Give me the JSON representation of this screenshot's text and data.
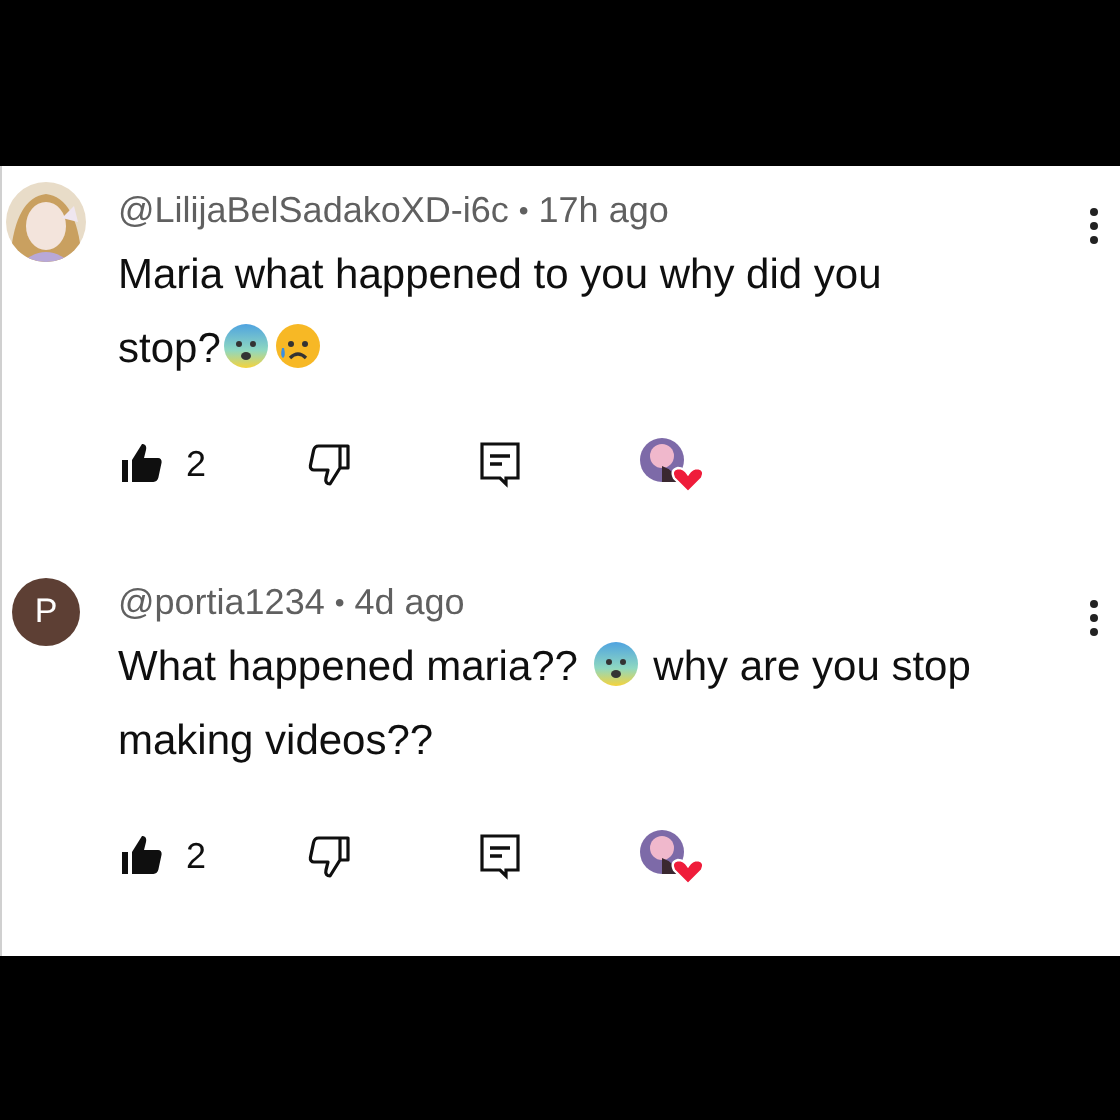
{
  "comments": [
    {
      "author": "@LilijaBelSadakoXD-i6c",
      "separator": "•",
      "time": "17h ago",
      "body": [
        {
          "kind": "text",
          "text": "Maria what happened to you why did you stop?"
        },
        {
          "kind": "fearful-emoji"
        },
        {
          "kind": "sad-emoji"
        }
      ],
      "liked": true,
      "likes": "2",
      "hearted": true
    },
    {
      "avatar": {
        "kind": "letter",
        "letter": "P",
        "color": "#5d3f34"
      },
      "author": "@portia1234",
      "separator": "•",
      "time": "4d ago",
      "body": [
        {
          "kind": "text",
          "text": "What happened maria?? "
        },
        {
          "kind": "fearful-emoji"
        },
        {
          "kind": "text",
          "text": " why are you stop making videos??"
        }
      ],
      "liked": true,
      "likes": "2",
      "hearted": true
    }
  ]
}
